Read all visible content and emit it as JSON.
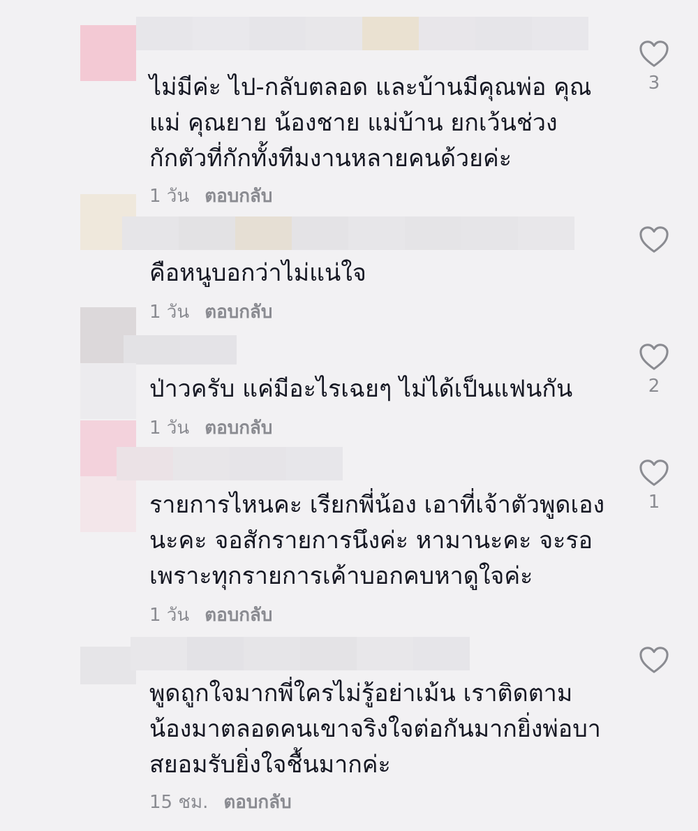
{
  "comments": [
    {
      "text": "ไม่มีค่ะ ไป-กลับตลอด และบ้านมีคุณพ่อ คุณ\nแม่ คุณยาย น้องชาย แม่บ้าน ยกเว้นช่วง\nกักตัวที่กักทั้งทีมงานหลายคนด้วยค่ะ",
      "time": "1 วัน",
      "reply": "ตอบกลับ",
      "likes": "3",
      "avatar_color": "#f3c9d4",
      "name_colors": [
        "#e7e6ea",
        "#e9e8ec",
        "#e6e5e9",
        "#e8e7ea",
        "#eae1d1",
        "#e8e6ea",
        "#e6e5e9",
        "#e8e7eb"
      ]
    },
    {
      "text": "คือหนูบอกว่าไม่แน่ใจ",
      "time": "1 วัน",
      "reply": "ตอบกลับ",
      "likes": "",
      "avatar_color": "#efe8dc",
      "name_colors": [
        "#e6e5e8",
        "#e3e2e4",
        "#e6dfd4",
        "#e4e3e6",
        "#e7e6e9",
        "#e5e4e7",
        "#e6e5e8",
        "#e8e7ea"
      ]
    },
    {
      "text": "ป่าวครับ แค่มีอะไรเฉยๆ ไม่ได้เป็นแฟนกัน",
      "time": "1 วัน",
      "reply": "ตอบกลับ",
      "likes": "2",
      "avatar_color": "#dcd8da",
      "name_colors": [
        "#e3e2e5",
        "#e4e3e7"
      ]
    },
    {
      "text": "รายการไหนคะ เรียกพี่น้อง เอาที่เจ้าตัวพูดเอง\nนะคะ จอสักรายการนึงค่ะ หามานะคะ จะรอ\nเพราะทุกรายการเค้าบอกคบหาดูใจค่ะ",
      "time": "1 วัน",
      "reply": "ตอบกลับ",
      "likes": "1",
      "avatar_color": "#f3d2dc",
      "name_colors": [
        "#ebe2e6",
        "#e8e6e9",
        "#e6e4e8",
        "#e7e6ea"
      ]
    },
    {
      "text": "พูดถูกใจมากพี่ใครไม่รู้อย่าเม้น เราติดตาม\nน้องมาตลอดคนเขาจริงใจต่อกันมากยิ่งพ่อบา\nสยอมรับยิ่งใจชื้นมากค่ะ",
      "time": "15 ชม.",
      "reply": "ตอบกลับ",
      "likes": "",
      "avatar_color": "#e6e5e8",
      "name_colors": [
        "#e8e7ea",
        "#e3e2e6",
        "#e6e5e8",
        "#e4e3e6",
        "#e8e7ea",
        "#e6e5e9"
      ]
    }
  ]
}
